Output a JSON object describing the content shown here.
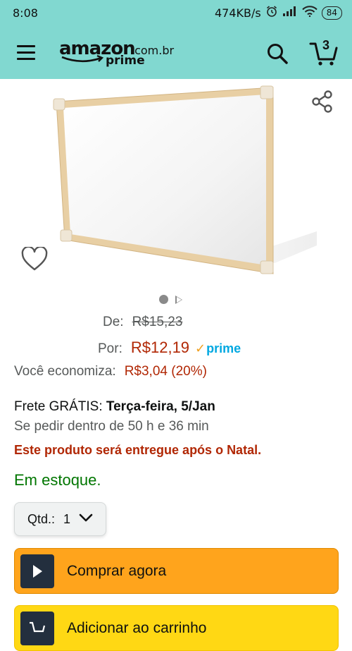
{
  "status_bar": {
    "time": "8:08",
    "network_speed": "474KB/s",
    "battery": "84"
  },
  "header": {
    "logo_word": "amazon",
    "logo_tld": ".com.br",
    "logo_prime": "prime",
    "cart_count": "3"
  },
  "price": {
    "de_label": "De:",
    "list_price": "R$15,23",
    "por_label": "Por:",
    "current_price": "R$12,19",
    "prime_check": "✓",
    "prime_label": "prime",
    "savings_label": "Você economiza:",
    "savings_value": "R$3,04 (20%)"
  },
  "delivery": {
    "free_label": "Frete GRÁTIS:",
    "date": "Terça-feira, 5/Jan",
    "order_within": "Se pedir dentro de 50 h e 36 min",
    "christmas_notice": "Este produto será entregue após o Natal.",
    "stock": "Em estoque."
  },
  "quantity": {
    "label": "Qtd.:",
    "value": "1"
  },
  "buttons": {
    "buy_now": "Comprar agora",
    "add_to_cart": "Adicionar ao carrinho"
  },
  "colors": {
    "header_bg": "#81d8d0",
    "price_red": "#b12704",
    "stock_green": "#007600",
    "buy_now_orange": "#ffa41c",
    "add_cart_yellow": "#ffd814",
    "prime_blue": "#00a8e1"
  },
  "icons": {
    "menu": "hamburger-icon",
    "search": "search-icon",
    "cart": "cart-icon",
    "share": "share-icon",
    "wishlist": "heart-icon",
    "buy_now": "play-icon",
    "add_cart": "cart-add-icon"
  },
  "carousel": {
    "total_items": 2,
    "selected_index": 0
  }
}
